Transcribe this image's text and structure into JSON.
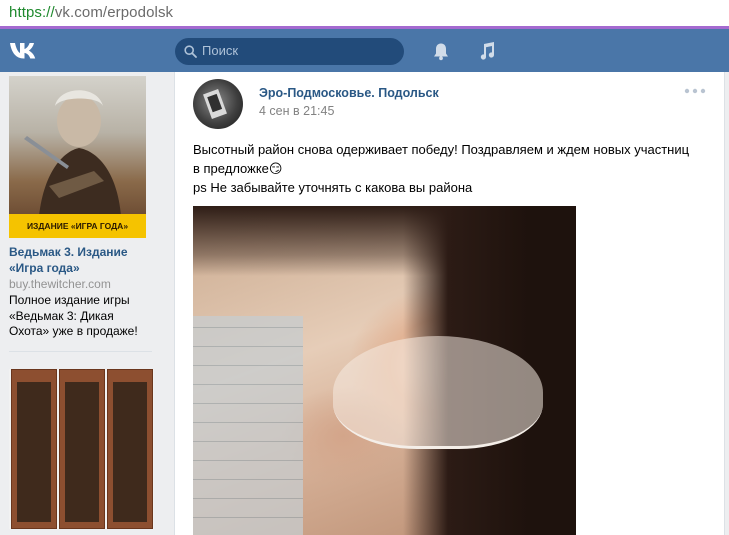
{
  "browser": {
    "url_protocol": "https://",
    "url_host": "vk.com/erpodolsk"
  },
  "header": {
    "logo_icon": "vk-logo-icon",
    "search_placeholder": "Поиск",
    "notifications_icon": "bell-icon",
    "music_icon": "music-note-icon",
    "colors": {
      "bar": "#4a76a8",
      "search": "#224b7a"
    }
  },
  "ads": [
    {
      "image_banner": "ИЗДАНИЕ «ИГРА ГОДА»",
      "title": "Ведьмак 3. Издание «Игра года»",
      "domain": "buy.thewitcher.com",
      "description": "Полное издание игры «Ведьмак 3: Дикая Охота» уже в продаже!"
    },
    {
      "image": "gun-safes"
    }
  ],
  "post": {
    "author": "Эро-Подмосковье. Подольск",
    "date": "4 сен в 21:45",
    "text_line1": "Высотный район снова одерживает победу! Поздравляем и ждем новых участниц",
    "text_line2": "в предложке",
    "emoji": "😏",
    "text_line3": "ps Не забывайте уточнять с какова вы района",
    "more_icon": "ellipsis-icon"
  }
}
